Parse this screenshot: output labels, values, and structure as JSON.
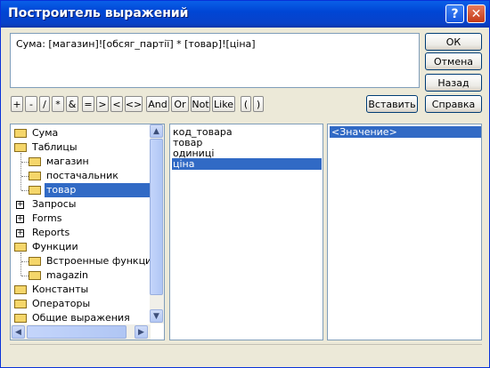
{
  "window": {
    "title": "Построитель выражений"
  },
  "expression": "Сума:  [магазин]![обсяг_партії] * [товар]![ціна]",
  "buttons": {
    "ok": "ОК",
    "cancel": "Отмена",
    "back": "Назад",
    "help": "Справка",
    "insert": "Вставить"
  },
  "operators": [
    "+",
    "-",
    "/",
    "*",
    "&",
    "=",
    ">",
    "<",
    "<>",
    "And",
    "Or",
    "Not",
    "Like",
    "(",
    ")"
  ],
  "tree": [
    {
      "label": "Сума",
      "type": "folder"
    },
    {
      "label": "Таблицы",
      "type": "folder-open"
    },
    {
      "label": "магазин",
      "type": "folder"
    },
    {
      "label": "постачальник",
      "type": "folder"
    },
    {
      "label": "товар",
      "type": "folder-open",
      "selected": true
    },
    {
      "label": "Запросы",
      "type": "plus"
    },
    {
      "label": "Forms",
      "type": "plus"
    },
    {
      "label": "Reports",
      "type": "plus"
    },
    {
      "label": "Функции",
      "type": "folder-open"
    },
    {
      "label": "Встроенные функции",
      "type": "folder"
    },
    {
      "label": "magazin",
      "type": "folder"
    },
    {
      "label": "Константы",
      "type": "folder"
    },
    {
      "label": "Операторы",
      "type": "folder"
    },
    {
      "label": "Общие выражения",
      "type": "folder"
    }
  ],
  "fields": [
    {
      "label": "код_товара"
    },
    {
      "label": "товар"
    },
    {
      "label": "одиниці"
    },
    {
      "label": "ціна",
      "selected": true
    }
  ],
  "values": [
    {
      "label": "<Значение>",
      "selected": true
    }
  ]
}
